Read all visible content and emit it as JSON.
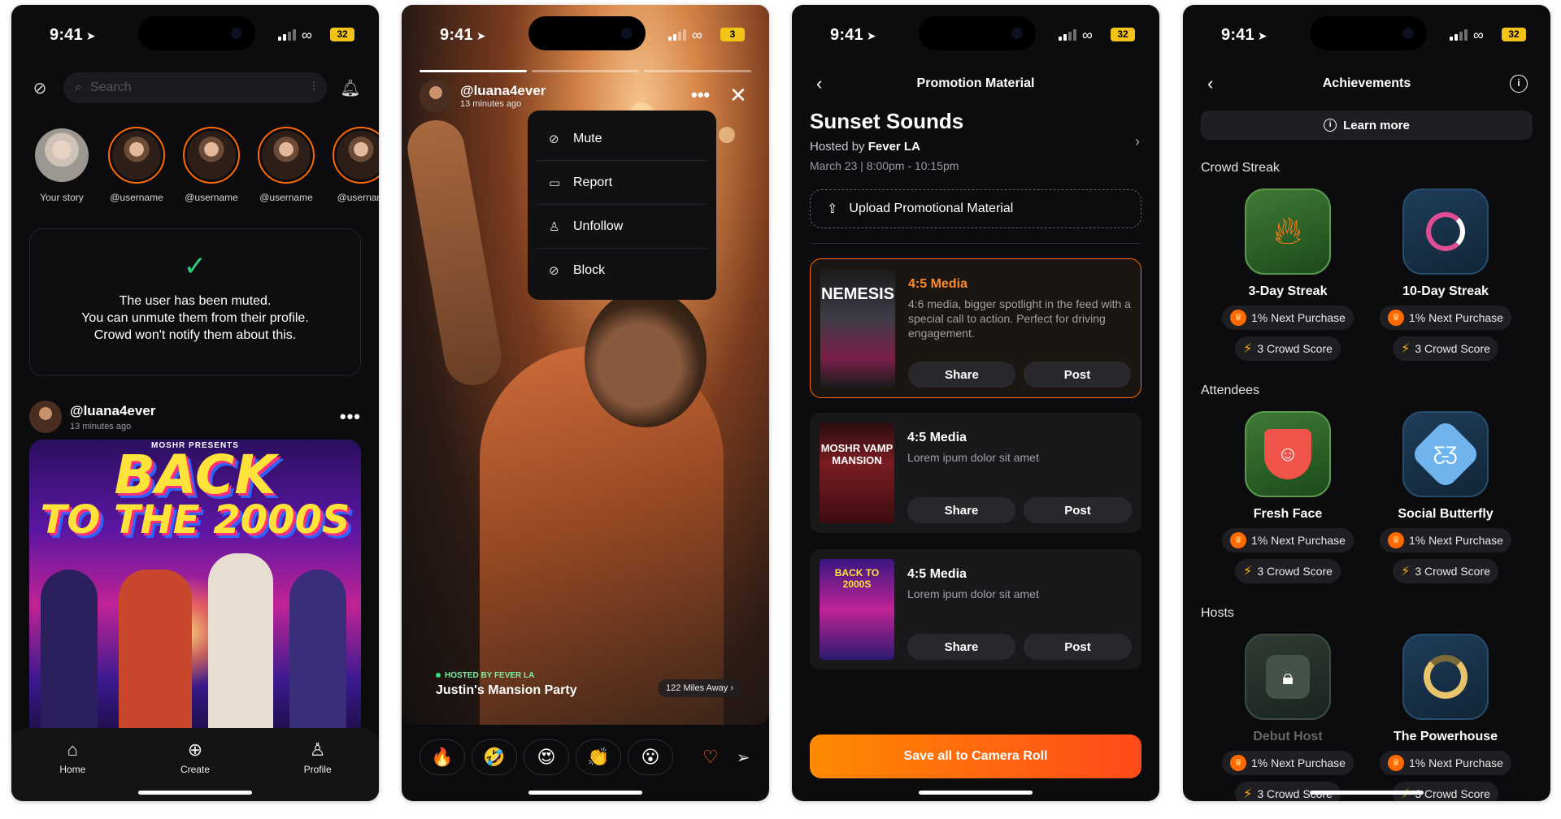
{
  "status": {
    "time": "9:41",
    "battery": "32",
    "battery_partial": "3"
  },
  "screen1": {
    "search_placeholder": "Search",
    "stories": [
      {
        "label": "Your story"
      },
      {
        "label": "@username"
      },
      {
        "label": "@username"
      },
      {
        "label": "@username"
      },
      {
        "label": "@usernam"
      }
    ],
    "muted": {
      "line1": "The user has been muted.",
      "line2": "You can unmute them from their profile.",
      "line3": "Crowd won't notify them about this."
    },
    "post": {
      "user": "@luana4ever",
      "time": "13 minutes ago",
      "poster_brand": "MOSHR PRESENTS",
      "poster_title_1": "BACK",
      "poster_title_2": "TO THE 2000S"
    },
    "tabs": {
      "home": "Home",
      "create": "Create",
      "profile": "Profile"
    }
  },
  "screen2": {
    "user": "@luana4ever",
    "time": "13 minutes ago",
    "menu": {
      "mute": "Mute",
      "report": "Report",
      "unfollow": "Unfollow",
      "block": "Block"
    },
    "host_tag": "HOSTED BY FEVER LA",
    "event_name": "Justin's Mansion Party",
    "distance": "122 Miles Away",
    "reactions": [
      "🔥",
      "🤣",
      "😍",
      "👏",
      "😮"
    ]
  },
  "screen3": {
    "title": "Promotion Material",
    "event_title": "Sunset Sounds",
    "hosted_prefix": "Hosted by",
    "host": "Fever LA",
    "date": "March 23 | 8:00pm - 10:15pm",
    "upload_label": "Upload Promotional Material",
    "media": [
      {
        "title": "4:5 Media",
        "desc": "4:6 media, bigger spotlight in the feed with a special call to action. Perfect for driving engagement.",
        "share": "Share",
        "post": "Post"
      },
      {
        "title": "4:5 Media",
        "desc": "Lorem ipum dolor sit amet",
        "share": "Share",
        "post": "Post"
      },
      {
        "title": "4:5 Media",
        "desc": "Lorem ipum dolor sit amet",
        "share": "Share",
        "post": "Post"
      }
    ],
    "thumb_labels": [
      "NEMESIS",
      "MOSHR VAMP MANSION",
      "BACK TO 2000S"
    ],
    "save_label": "Save all to Camera Roll"
  },
  "screen4": {
    "title": "Achievements",
    "learn_more": "Learn more",
    "sections": {
      "streak": "Crowd Streak",
      "attendees": "Attendees",
      "hosts": "Hosts"
    },
    "achievements": [
      {
        "name": "3-Day Streak",
        "reward": "1% Next Purchase",
        "score": "3 Crowd Score"
      },
      {
        "name": "10-Day Streak",
        "reward": "1% Next Purchase",
        "score": "3 Crowd Score"
      },
      {
        "name": "Fresh Face",
        "reward": "1% Next Purchase",
        "score": "3 Crowd Score"
      },
      {
        "name": "Social Butterfly",
        "reward": "1% Next Purchase",
        "score": "3 Crowd Score"
      },
      {
        "name": "Debut Host",
        "reward": "1% Next Purchase",
        "score": "3 Crowd Score"
      },
      {
        "name": "The Powerhouse",
        "reward": "1% Next Purchase",
        "score": "3 Crowd Score"
      }
    ]
  },
  "colors": {
    "accent": "#ff6a00",
    "success": "#2fce74",
    "background": "#0c0c0e"
  }
}
